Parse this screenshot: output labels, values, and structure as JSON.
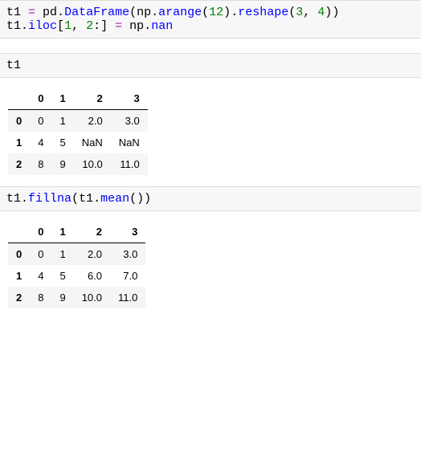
{
  "cell1": {
    "line1": {
      "v1": "t1",
      "eq": " = ",
      "v2": "pd",
      "dot1": ".",
      "fn1": "DataFrame",
      "lp1": "(",
      "v3": "np",
      "dot2": ".",
      "fn2": "arange",
      "lp2": "(",
      "n1": "12",
      "rp2": ")",
      "dot3": ".",
      "fn3": "reshape",
      "lp3": "(",
      "n2": "3",
      "comma": ",",
      "sp": " ",
      "n3": "4",
      "rp3": ")",
      "rp1": ")"
    },
    "line2": {
      "v1": "t1",
      "dot1": ".",
      "fn1": "iloc",
      "lb": "[",
      "n1": "1",
      "comma": ",",
      "sp": " ",
      "n2": "2",
      "colon": ":",
      "rb": "]",
      "eq": " = ",
      "v2": "np",
      "dot2": ".",
      "fn2": "nan"
    }
  },
  "cell2": {
    "line1": {
      "v1": "t1"
    }
  },
  "table1": {
    "cols": [
      "0",
      "1",
      "2",
      "3"
    ],
    "rows": [
      {
        "idx": "0",
        "c": [
          "0",
          "1",
          "2.0",
          "3.0"
        ]
      },
      {
        "idx": "1",
        "c": [
          "4",
          "5",
          "NaN",
          "NaN"
        ]
      },
      {
        "idx": "2",
        "c": [
          "8",
          "9",
          "10.0",
          "11.0"
        ]
      }
    ]
  },
  "cell3": {
    "line1": {
      "v1": "t1",
      "dot1": ".",
      "fn1": "fillna",
      "lp": "(",
      "v2": "t1",
      "dot2": ".",
      "fn2": "mean",
      "lp2": "(",
      "rp2": ")",
      "rp": ")"
    }
  },
  "table2": {
    "cols": [
      "0",
      "1",
      "2",
      "3"
    ],
    "rows": [
      {
        "idx": "0",
        "c": [
          "0",
          "1",
          "2.0",
          "3.0"
        ]
      },
      {
        "idx": "1",
        "c": [
          "4",
          "5",
          "6.0",
          "7.0"
        ]
      },
      {
        "idx": "2",
        "c": [
          "8",
          "9",
          "10.0",
          "11.0"
        ]
      }
    ]
  }
}
